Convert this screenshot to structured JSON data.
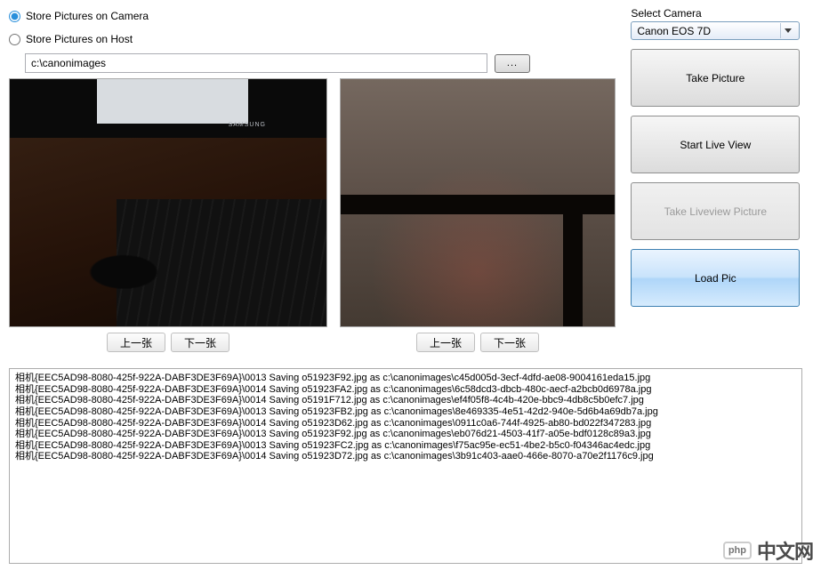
{
  "storage": {
    "camera_label": "Store Pictures on Camera",
    "host_label": "Store Pictures on Host",
    "path_value": "c:\\canonimages",
    "browse_label": "..."
  },
  "previews": {
    "left": {
      "prev": "上一张",
      "next": "下一张"
    },
    "right": {
      "prev": "上一张",
      "next": "下一张"
    }
  },
  "camera_panel": {
    "select_label": "Select Camera",
    "selected": "Canon EOS 7D",
    "take_picture": "Take Picture",
    "start_liveview": "Start Live View",
    "take_liveview_picture": "Take Liveview Picture",
    "load_pic": "Load Pic"
  },
  "log_lines": [
    "相机{EEC5AD98-8080-425f-922A-DABF3DE3F69A}\\0013  Saving o51923F92.jpg as c:\\canonimages\\c45d005d-3ecf-4dfd-ae08-9004161eda15.jpg",
    "相机{EEC5AD98-8080-425f-922A-DABF3DE3F69A}\\0014  Saving o51923FA2.jpg as c:\\canonimages\\6c58dcd3-dbcb-480c-aecf-a2bcb0d6978a.jpg",
    "相机{EEC5AD98-8080-425f-922A-DABF3DE3F69A}\\0014  Saving o5191F712.jpg as c:\\canonimages\\ef4f05f8-4c4b-420e-bbc9-4db8c5b0efc7.jpg",
    "相机{EEC5AD98-8080-425f-922A-DABF3DE3F69A}\\0013  Saving o51923FB2.jpg as c:\\canonimages\\8e469335-4e51-42d2-940e-5d6b4a69db7a.jpg",
    "相机{EEC5AD98-8080-425f-922A-DABF3DE3F69A}\\0014  Saving o51923D62.jpg as c:\\canonimages\\0911c0a6-744f-4925-ab80-bd022f347283.jpg",
    "相机{EEC5AD98-8080-425f-922A-DABF3DE3F69A}\\0013  Saving o51923F92.jpg as c:\\canonimages\\eb076d21-4503-41f7-a05e-bdf0128c89a3.jpg",
    "相机{EEC5AD98-8080-425f-922A-DABF3DE3F69A}\\0013  Saving o51923FC2.jpg as c:\\canonimages\\f75ac95e-ec51-4be2-b5c0-f04346ac4edc.jpg",
    "相机{EEC5AD98-8080-425f-922A-DABF3DE3F69A}\\0014  Saving o51923D72.jpg as c:\\canonimages\\3b91c403-aae0-466e-8070-a70e2f1176c9.jpg"
  ],
  "watermark": {
    "badge": "php",
    "text": "中文网"
  }
}
